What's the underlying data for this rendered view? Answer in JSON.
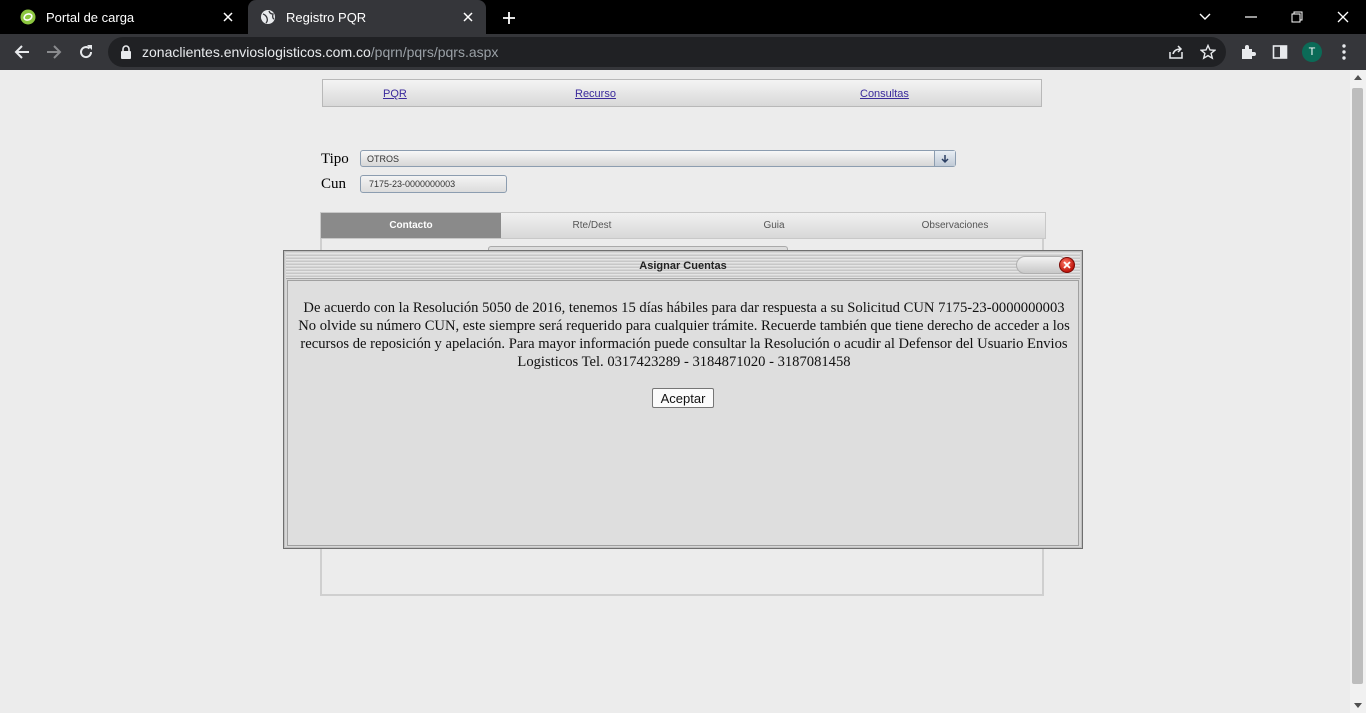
{
  "browser": {
    "tabs": [
      {
        "title": "Portal de carga",
        "icon": "portal-favicon-icon",
        "active": false
      },
      {
        "title": "Registro PQR",
        "icon": "globe-icon",
        "active": true
      }
    ],
    "url_host": "zonaclientes.envioslogisticos.com.co",
    "url_path": "/pqrn/pqrs/pqrs.aspx",
    "profile_initial": "T",
    "colors": {
      "tabbar": "#000000",
      "toolbar": "#35363a",
      "omnibox": "#202124",
      "profile": "#0b6b57"
    }
  },
  "page": {
    "menu": {
      "pqr": "PQR",
      "recurso": "Recurso",
      "consultas": "Consultas"
    },
    "form": {
      "tipo_label": "Tipo",
      "tipo_value": "OTROS",
      "cun_label": "Cun",
      "cun_value": "7175-23-0000000003"
    },
    "tabs": [
      {
        "label": "Contacto",
        "active": true
      },
      {
        "label": "Rte/Dest",
        "active": false
      },
      {
        "label": "Guia",
        "active": false
      },
      {
        "label": "Observaciones",
        "active": false
      }
    ]
  },
  "dialog": {
    "title": "Asignar Cuentas",
    "message": "De acuerdo con la Resolución 5050 de 2016, tenemos 15 días hábiles para dar respuesta a su Solicitud CUN 7175-23-0000000003 No olvide su número CUN, este siempre será requerido para cualquier trámite. Recuerde también que tiene derecho de acceder a los recursos de reposición y apelación. Para mayor información puede consultar la Resolución o acudir al Defensor del Usuario Envios Logisticos Tel. 0317423289 - 3184871020 - 3187081458",
    "ok_label": "Aceptar"
  }
}
